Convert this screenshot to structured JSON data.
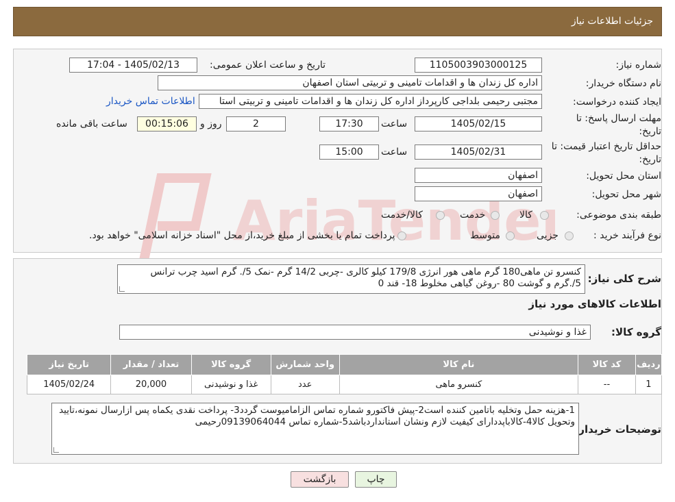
{
  "header": {
    "title": "جزئیات اطلاعات نیاز"
  },
  "need": {
    "number_label": "شماره نیاز:",
    "number": "1105003903000125",
    "announce_label": "تاریخ و ساعت اعلان عمومی:",
    "announce_value": "1405/02/13 - 17:04",
    "buyer_label": "نام دستگاه خریدار:",
    "buyer": "اداره کل زندان ها و اقدامات تامینی و تربیتی استان اصفهان",
    "creator_label": "ایجاد کننده درخواست:",
    "creator": "مجتبی رحیمی بلداجی کارپرداز اداره کل زندان ها و اقدامات تامینی و تربیتی استا",
    "contact_link": "اطلاعات تماس خریدار",
    "deadline_label_1": "مهلت ارسال پاسخ: تا",
    "deadline_label_2": "تاریخ:",
    "deadline_date": "1405/02/15",
    "time_label": "ساعت",
    "deadline_time": "17:30",
    "days": "2",
    "days_label": "روز و",
    "remaining": "00:15:06",
    "remaining_label": "ساعت باقی مانده",
    "validity_label_1": "حداقل تاریخ اعتبار قیمت: تا",
    "validity_label_2": "تاریخ:",
    "validity_date": "1405/02/31",
    "validity_time": "15:00",
    "province_label": "استان محل تحویل:",
    "province": "اصفهان",
    "city_label": "شهر محل تحویل:",
    "city": "اصفهان",
    "category_label": "طبقه بندی موضوعی:",
    "category_options": [
      "کالا",
      "خدمت",
      "کالا/خدمت"
    ],
    "process_label": "نوع فرآیند خرید :",
    "process_options": [
      "جزیی",
      "متوسط"
    ],
    "process_note": "پرداخت تمام یا بخشی از مبلغ خرید،از محل \"اسناد خزانه اسلامی\" خواهد بود."
  },
  "summary": {
    "label": "شرح کلی نیاز:",
    "text": "کنسرو تن ماهی180 گرم ماهی هور انرژی 179/8 کیلو کالری -چربی 14/2 گرم -نمک 5/. گرم اسید چرب ترانس 5/.گرم و گوشت 80 -روغن گیاهی مخلوط 18- قند 0",
    "goods_info_title": "اطلاعات کالاهای مورد نیاز",
    "group_label": "گروه کالا:",
    "group_value": "غذا و نوشیدنی"
  },
  "table": {
    "headers": [
      "ردیف",
      "کد کالا",
      "نام کالا",
      "واحد شمارش",
      "گروه کالا",
      "تعداد / مقدار",
      "تاریخ نیاز"
    ],
    "rows": [
      [
        "1",
        "--",
        "کنسرو ماهی",
        "عدد",
        "غذا و نوشیدنی",
        "20,000",
        "1405/02/24"
      ]
    ]
  },
  "buyer_notes": {
    "label": "توضیحات خریدار:",
    "text": "1-هزینه حمل وتخلیه باتامین کننده است2-پیش فاکتورو شماره تماس الزامامیوست گردد3- پرداخت نقدی یکماه پس ازارسال نمونه،تایید وتحویل کالا4-کالاباپددارای کیفیت لازم ونشان استانداردباشد5-شماره تماس 09139064044رحیمی"
  },
  "buttons": {
    "print": "چاپ",
    "back": "بازگشت"
  },
  "watermark": {
    "text": "AriaTender.neT"
  }
}
